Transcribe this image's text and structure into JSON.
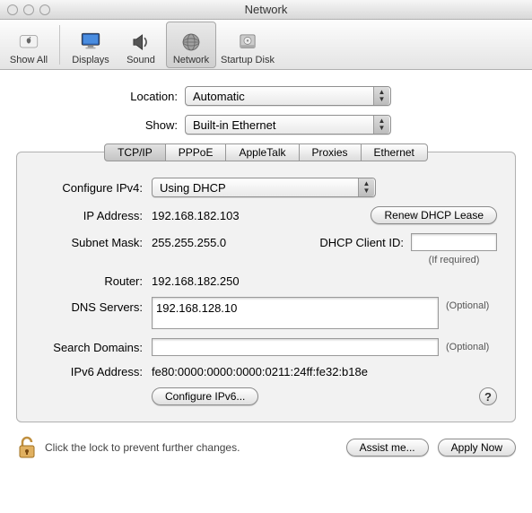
{
  "window": {
    "title": "Network"
  },
  "toolbar": {
    "items": [
      {
        "label": "Show All"
      },
      {
        "label": "Displays"
      },
      {
        "label": "Sound"
      },
      {
        "label": "Network"
      },
      {
        "label": "Startup Disk"
      }
    ]
  },
  "selectors": {
    "location_label": "Location:",
    "location_value": "Automatic",
    "show_label": "Show:",
    "show_value": "Built-in Ethernet"
  },
  "tabs": [
    "TCP/IP",
    "PPPoE",
    "AppleTalk",
    "Proxies",
    "Ethernet"
  ],
  "tcpip": {
    "configure_label": "Configure IPv4:",
    "configure_value": "Using DHCP",
    "ip_label": "IP Address:",
    "ip_value": "192.168.182.103",
    "renew_label": "Renew DHCP Lease",
    "subnet_label": "Subnet Mask:",
    "subnet_value": "255.255.255.0",
    "dhcp_client_label": "DHCP Client ID:",
    "dhcp_client_value": "",
    "dhcp_client_note": "(If required)",
    "router_label": "Router:",
    "router_value": "192.168.182.250",
    "dns_label": "DNS Servers:",
    "dns_value": "192.168.128.10",
    "optional": "(Optional)",
    "search_label": "Search Domains:",
    "search_value": "",
    "ipv6_addr_label": "IPv6 Address:",
    "ipv6_addr_value": "fe80:0000:0000:0000:0211:24ff:fe32:b18e",
    "configure_ipv6_label": "Configure IPv6...",
    "help_label": "?"
  },
  "footer": {
    "lock_text": "Click the lock to prevent further changes.",
    "assist_label": "Assist me...",
    "apply_label": "Apply Now"
  }
}
